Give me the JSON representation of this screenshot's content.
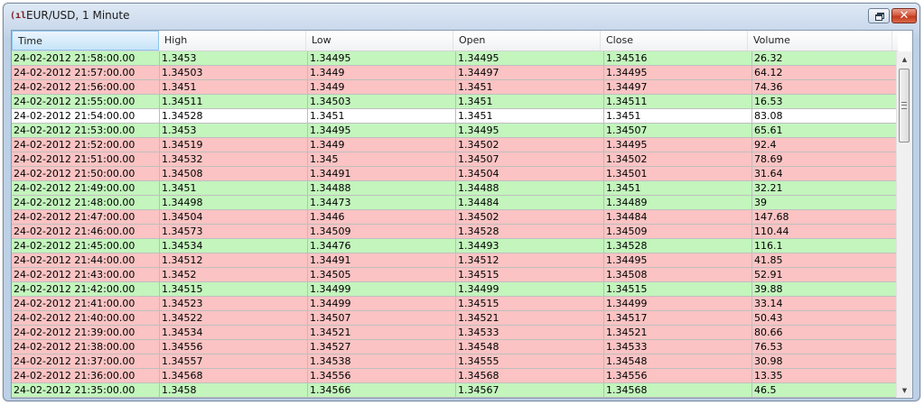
{
  "window": {
    "title": "EUR/USD, 1 Minute",
    "icon": "chart-signal-icon",
    "close_glyph": "✕"
  },
  "table": {
    "columns": [
      "Time",
      "High",
      "Low",
      "Open",
      "Close",
      "Volume"
    ],
    "selected_column": "Time",
    "colors": {
      "up": "#c3f5bd",
      "down": "#fbc3c3",
      "flat": "#ffffff"
    },
    "rows": [
      {
        "trend": "up",
        "cells": [
          "24-02-2012 21:58:00.00",
          "1.3453",
          "1.34495",
          "1.34495",
          "1.34516",
          "26.32"
        ]
      },
      {
        "trend": "down",
        "cells": [
          "24-02-2012 21:57:00.00",
          "1.34503",
          "1.3449",
          "1.34497",
          "1.34495",
          "64.12"
        ]
      },
      {
        "trend": "down",
        "cells": [
          "24-02-2012 21:56:00.00",
          "1.3451",
          "1.3449",
          "1.3451",
          "1.34497",
          "74.36"
        ]
      },
      {
        "trend": "up",
        "cells": [
          "24-02-2012 21:55:00.00",
          "1.34511",
          "1.34503",
          "1.3451",
          "1.34511",
          "16.53"
        ]
      },
      {
        "trend": "flat",
        "cells": [
          "24-02-2012 21:54:00.00",
          "1.34528",
          "1.3451",
          "1.3451",
          "1.3451",
          "83.08"
        ]
      },
      {
        "trend": "up",
        "cells": [
          "24-02-2012 21:53:00.00",
          "1.3453",
          "1.34495",
          "1.34495",
          "1.34507",
          "65.61"
        ]
      },
      {
        "trend": "down",
        "cells": [
          "24-02-2012 21:52:00.00",
          "1.34519",
          "1.3449",
          "1.34502",
          "1.34495",
          "92.4"
        ]
      },
      {
        "trend": "down",
        "cells": [
          "24-02-2012 21:51:00.00",
          "1.34532",
          "1.345",
          "1.34507",
          "1.34502",
          "78.69"
        ]
      },
      {
        "trend": "down",
        "cells": [
          "24-02-2012 21:50:00.00",
          "1.34508",
          "1.34491",
          "1.34504",
          "1.34501",
          "31.64"
        ]
      },
      {
        "trend": "up",
        "cells": [
          "24-02-2012 21:49:00.00",
          "1.3451",
          "1.34488",
          "1.34488",
          "1.3451",
          "32.21"
        ]
      },
      {
        "trend": "up",
        "cells": [
          "24-02-2012 21:48:00.00",
          "1.34498",
          "1.34473",
          "1.34484",
          "1.34489",
          "39"
        ]
      },
      {
        "trend": "down",
        "cells": [
          "24-02-2012 21:47:00.00",
          "1.34504",
          "1.3446",
          "1.34502",
          "1.34484",
          "147.68"
        ]
      },
      {
        "trend": "down",
        "cells": [
          "24-02-2012 21:46:00.00",
          "1.34573",
          "1.34509",
          "1.34528",
          "1.34509",
          "110.44"
        ]
      },
      {
        "trend": "up",
        "cells": [
          "24-02-2012 21:45:00.00",
          "1.34534",
          "1.34476",
          "1.34493",
          "1.34528",
          "116.1"
        ]
      },
      {
        "trend": "down",
        "cells": [
          "24-02-2012 21:44:00.00",
          "1.34512",
          "1.34491",
          "1.34512",
          "1.34495",
          "41.85"
        ]
      },
      {
        "trend": "down",
        "cells": [
          "24-02-2012 21:43:00.00",
          "1.3452",
          "1.34505",
          "1.34515",
          "1.34508",
          "52.91"
        ]
      },
      {
        "trend": "up",
        "cells": [
          "24-02-2012 21:42:00.00",
          "1.34515",
          "1.34499",
          "1.34499",
          "1.34515",
          "39.88"
        ]
      },
      {
        "trend": "down",
        "cells": [
          "24-02-2012 21:41:00.00",
          "1.34523",
          "1.34499",
          "1.34515",
          "1.34499",
          "33.14"
        ]
      },
      {
        "trend": "down",
        "cells": [
          "24-02-2012 21:40:00.00",
          "1.34522",
          "1.34507",
          "1.34521",
          "1.34517",
          "50.43"
        ]
      },
      {
        "trend": "down",
        "cells": [
          "24-02-2012 21:39:00.00",
          "1.34534",
          "1.34521",
          "1.34533",
          "1.34521",
          "80.66"
        ]
      },
      {
        "trend": "down",
        "cells": [
          "24-02-2012 21:38:00.00",
          "1.34556",
          "1.34527",
          "1.34548",
          "1.34533",
          "76.53"
        ]
      },
      {
        "trend": "down",
        "cells": [
          "24-02-2012 21:37:00.00",
          "1.34557",
          "1.34538",
          "1.34555",
          "1.34548",
          "30.98"
        ]
      },
      {
        "trend": "down",
        "cells": [
          "24-02-2012 21:36:00.00",
          "1.34568",
          "1.34556",
          "1.34568",
          "1.34556",
          "13.35"
        ]
      },
      {
        "trend": "up",
        "cells": [
          "24-02-2012 21:35:00.00",
          "1.3458",
          "1.34566",
          "1.34567",
          "1.34568",
          "46.5"
        ]
      }
    ]
  },
  "scrollbar": {
    "position": 0
  }
}
